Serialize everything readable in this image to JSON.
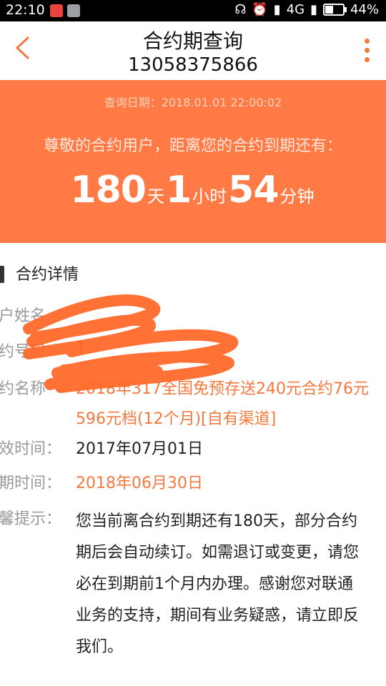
{
  "status_bar": {
    "time": "22:10",
    "network": "4G",
    "battery": "44%",
    "battery_level": 0.44
  },
  "header": {
    "title": "合约期查询",
    "phone": "13058375866",
    "back_icon": "chevron-left-icon",
    "more_icon": "more-vertical-icon",
    "accent_color": "#f4793e"
  },
  "banner": {
    "query_date": "查询日期：2018.01.01 22:00:02",
    "greeting": "尊敬的合约用户，距离您的合约到期还有：",
    "days": "180",
    "days_unit": "天",
    "hours": "1",
    "hours_unit": "小时",
    "minutes": "54",
    "minutes_unit": "分钟",
    "color": "#ff7a45"
  },
  "details": {
    "section_title": "合约详情",
    "rows": [
      {
        "label": "户姓名",
        "value": ""
      },
      {
        "label": "约号码",
        "value": "1"
      },
      {
        "label": "约名称",
        "value_line1": "2018年317全国免预存送240元合约76元",
        "value_line2": "596元档(12个月)[自有渠道]"
      },
      {
        "label": "效时间：",
        "value": "2017年07月01日"
      },
      {
        "label": "期时间：",
        "value": "2018年06月30日"
      }
    ],
    "tip_label": "馨提示：",
    "tip_lines": [
      "您当前离合约到期还有180天，部分合约",
      "期后会自动续订。如需退订或变更，请您",
      "必在到期前1个月内办理。感谢您对联通",
      "业务的支持，期间有业务疑惑，请立即反",
      "我们。"
    ]
  }
}
